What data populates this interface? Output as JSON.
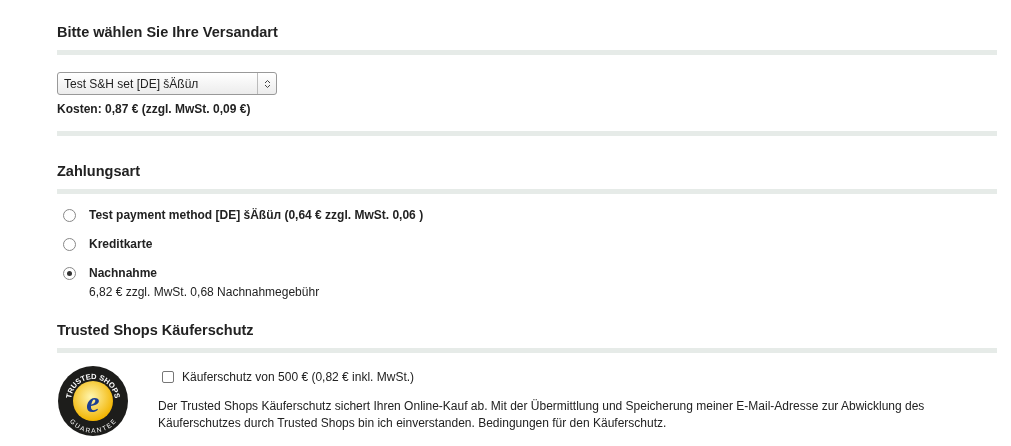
{
  "shipping": {
    "heading": "Bitte wählen Sie Ihre Versandart",
    "select_value": "Test S&H set [DE] šÄßüл",
    "cost": "Kosten: 0,87 € (zzgl. MwSt. 0,09 €)"
  },
  "payment": {
    "heading": "Zahlungsart",
    "options": [
      {
        "label": "Test payment method [DE] šÄßüл (0,64 € zzgl. MwSt. 0,06 )",
        "selected": false
      },
      {
        "label": "Kreditkarte",
        "selected": false
      },
      {
        "label": "Nachnahme",
        "selected": true,
        "note": "6,82 € zzgl. MwSt. 0,68 Nachnahmegebühr"
      }
    ]
  },
  "trusted_shops": {
    "heading": "Trusted Shops Käuferschutz",
    "logo": {
      "top": "TRUSTED SHOPS",
      "letter": "e",
      "bottom": "GUARANTEE"
    },
    "protection": {
      "label": "Käuferschutz von 500 € (0,82 € inkl. MwSt.)",
      "checked": false
    },
    "description": "Der Trusted Shops Käuferschutz sichert Ihren Online-Kauf ab. Mit der Übermittlung und Speicherung meiner E-Mail-Adresse zur Abwicklung des Käuferschutzes durch Trusted Shops bin ich einverstanden. Bedingungen für den Käuferschutz."
  }
}
